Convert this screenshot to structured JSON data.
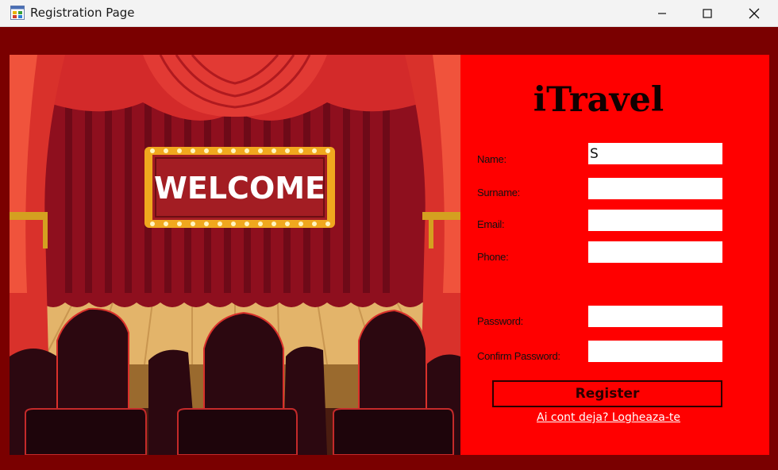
{
  "window": {
    "title": "Registration Page",
    "icon": "app-window-icon"
  },
  "controls": {
    "minimize_icon": "minimize-icon",
    "maximize_icon": "maximize-icon",
    "close_icon": "close-icon"
  },
  "stage_image": {
    "banner_text": "WELCOME"
  },
  "form": {
    "brand": "iTravel",
    "name_label": "Name:",
    "name_value": "S",
    "surname_label": "Surname:",
    "surname_value": "",
    "email_label": "Email:",
    "email_value": "",
    "phone_label": "Phone:",
    "phone_value": "",
    "password_label": "Password:",
    "password_value": "",
    "confirm_label": "Confirm Password:",
    "confirm_value": "",
    "register_label": "Register",
    "login_link": "Ai cont deja? Logheaza-te"
  },
  "colors": {
    "frame": "#7a0000",
    "panel": "#ff0000",
    "text": "#111111"
  }
}
